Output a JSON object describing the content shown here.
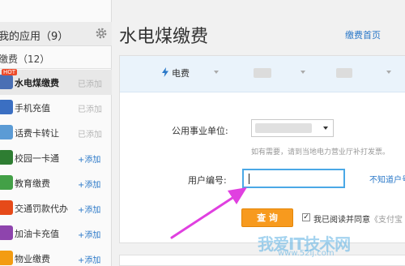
{
  "sidebar": {
    "header": "我的应用（9）",
    "subheader": "缴费（12）",
    "items": [
      {
        "label": "水电煤缴费",
        "action": "已添加",
        "icon_color": "#4a6fb4",
        "badge": "HOT",
        "active": true
      },
      {
        "label": "手机充值",
        "action": "已添加",
        "icon_color": "#3b6fc2"
      },
      {
        "label": "话费卡转让",
        "action": "已添加",
        "icon_color": "#5b9bd5"
      },
      {
        "label": "校园一卡通",
        "action": "+添加",
        "icon_color": "#2e7d32"
      },
      {
        "label": "教育缴费",
        "action": "+添加",
        "icon_color": "#43a047"
      },
      {
        "label": "交通罚款代办",
        "action": "+添加",
        "icon_color": "#e64a19"
      },
      {
        "label": "加油卡充值",
        "action": "+添加",
        "icon_color": "#8e44ad"
      },
      {
        "label": "物业缴费",
        "action": "+添加",
        "icon_color": "#f39c12"
      }
    ]
  },
  "main": {
    "title": "水电煤缴费",
    "home_link": "缴费首页",
    "tabs": [
      {
        "label": "电费",
        "icon": "lightning-icon",
        "active": true
      },
      {
        "label": "",
        "icon": "",
        "active": false
      },
      {
        "label": "",
        "icon": "",
        "active": false
      }
    ],
    "form": {
      "company_label": "公用事业单位:",
      "company_hint": "如有需要，请到当地电力营业厅补打发票。",
      "user_no_label": "用户编号:",
      "user_no_value": "",
      "unknown_link": "不知道户号",
      "submit_label": "查 询",
      "agree_text": "我已阅读并同意",
      "agree_link": "《支付宝",
      "agree_checked": true
    }
  },
  "watermark": {
    "main": "我爱IT技术网",
    "sub": "www.52ij.com"
  },
  "colors": {
    "accent": "#2a78c8",
    "button": "#f79a1e",
    "input_border": "#4aa8e6",
    "arrow": "#e040e0",
    "tab_bar": "#eaf3fb"
  }
}
